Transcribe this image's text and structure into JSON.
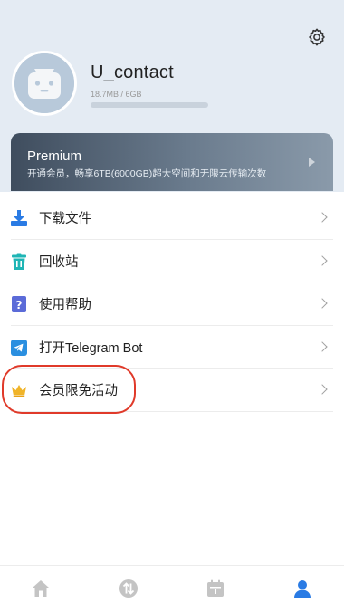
{
  "profile": {
    "username": "U_contact",
    "storage_text": "18.7MB / 6GB",
    "storage_used_fraction": 0.003
  },
  "premium": {
    "title": "Premium",
    "subtitle": "开通会员，畅享6TB(6000GB)超大空间和无限云传输次数"
  },
  "menu": {
    "items": [
      {
        "label": "下载文件",
        "icon": "download-icon"
      },
      {
        "label": "回收站",
        "icon": "trash-icon"
      },
      {
        "label": "使用帮助",
        "icon": "help-icon"
      },
      {
        "label": "打开Telegram Bot",
        "icon": "telegram-icon"
      },
      {
        "label": "会员限免活动",
        "icon": "crown-icon"
      }
    ]
  },
  "tabs": [
    {
      "icon": "home-icon"
    },
    {
      "icon": "transfer-icon"
    },
    {
      "icon": "calendar-icon"
    },
    {
      "icon": "profile-icon",
      "active": true
    }
  ],
  "colors": {
    "header_bg": "#e4ebf3",
    "accent_blue": "#2a7be4",
    "highlight_red": "#e03a2a",
    "crown_gold": "#f0b429"
  }
}
